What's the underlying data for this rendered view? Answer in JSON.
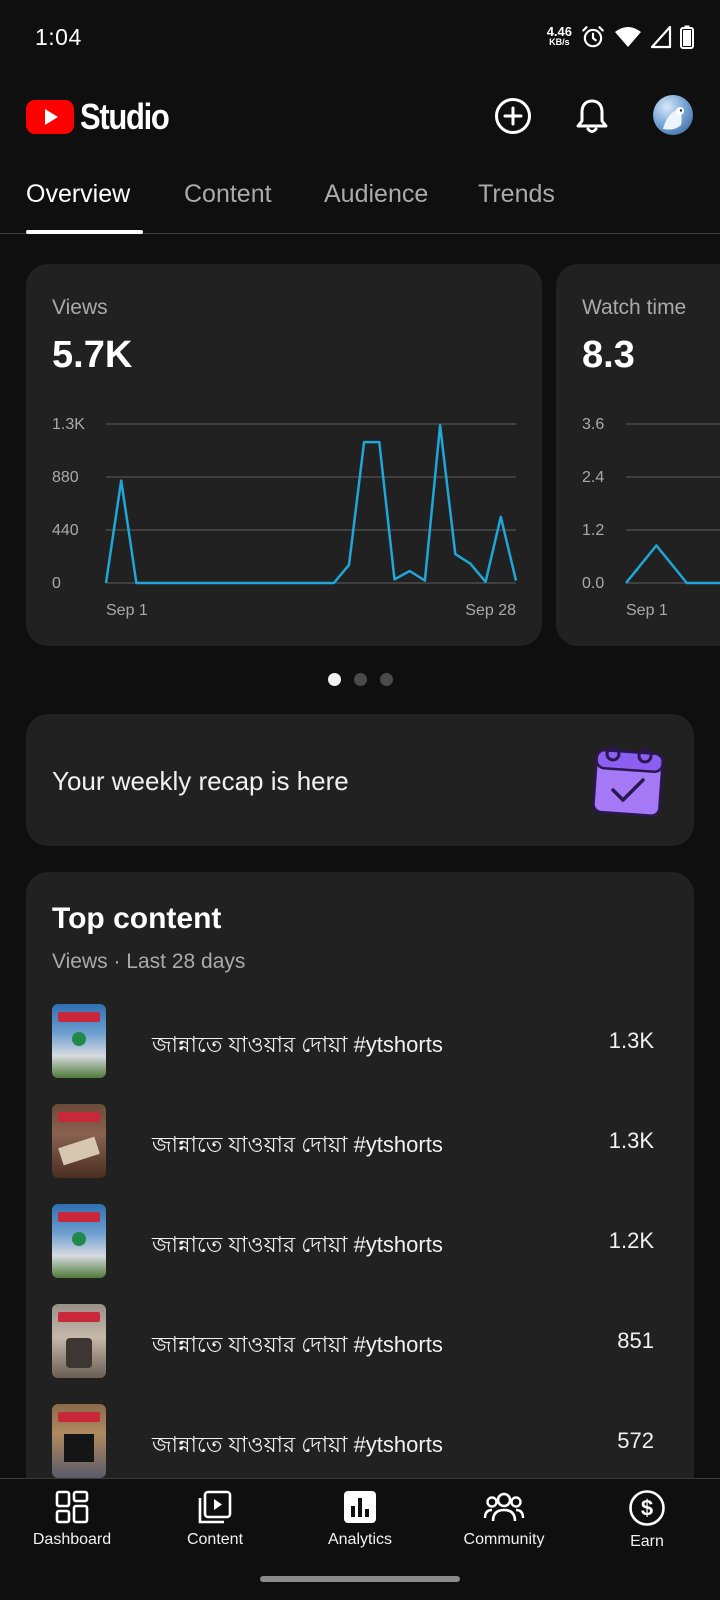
{
  "status_bar": {
    "time": "1:04",
    "net_speed_value": "4.46",
    "net_speed_unit": "KB/s"
  },
  "app": {
    "name": "Studio",
    "brand_color": "#ff0000"
  },
  "tabs": [
    {
      "label": "Overview",
      "active": true
    },
    {
      "label": "Content",
      "active": false
    },
    {
      "label": "Audience",
      "active": false
    },
    {
      "label": "Trends",
      "active": false
    }
  ],
  "metrics": [
    {
      "label": "Views",
      "value": "5.7K",
      "yticks": [
        "1.3K",
        "880",
        "440",
        "0"
      ],
      "xticks": [
        "Sep 1",
        "Sep 28"
      ]
    },
    {
      "label": "Watch time",
      "value": "8.3",
      "yticks": [
        "3.6",
        "2.4",
        "1.2",
        "0.0"
      ],
      "xticks": [
        "Sep 1"
      ]
    }
  ],
  "chart_data": [
    {
      "type": "line",
      "title": "Views",
      "x": [
        "Sep 1",
        "Sep 2",
        "Sep 3",
        "Sep 4",
        "Sep 5",
        "Sep 6",
        "Sep 7",
        "Sep 8",
        "Sep 9",
        "Sep 10",
        "Sep 11",
        "Sep 12",
        "Sep 13",
        "Sep 14",
        "Sep 15",
        "Sep 16",
        "Sep 17",
        "Sep 18",
        "Sep 19",
        "Sep 20",
        "Sep 21",
        "Sep 22",
        "Sep 23",
        "Sep 24",
        "Sep 25",
        "Sep 26",
        "Sep 27",
        "Sep 28"
      ],
      "values": [
        0,
        850,
        0,
        0,
        0,
        0,
        0,
        0,
        0,
        0,
        0,
        0,
        0,
        0,
        0,
        0,
        150,
        1170,
        1170,
        30,
        100,
        20,
        1310,
        240,
        160,
        10,
        550,
        20
      ],
      "ylim": [
        0,
        1320
      ],
      "yticks": [
        "0",
        "440",
        "880",
        "1.3K"
      ],
      "grid": true,
      "color": "#1ea7d8"
    },
    {
      "type": "line",
      "title": "Watch time",
      "x": [
        "Sep 1",
        "Sep 2",
        "Sep 3",
        "Sep 4",
        "Sep 5",
        "Sep 6"
      ],
      "values": [
        0,
        0.85,
        0,
        0,
        0,
        0
      ],
      "ylim": [
        0,
        3.6
      ],
      "yticks": [
        "0.0",
        "1.2",
        "2.4",
        "3.6"
      ],
      "grid": true,
      "color": "#1ea7d8"
    }
  ],
  "pager": {
    "count": 3,
    "active": 0
  },
  "recap": {
    "text": "Your weekly recap is here",
    "icon": "calendar-check-icon",
    "icon_color": "#9c6cf3"
  },
  "top_content": {
    "title": "Top content",
    "subtitle": "Views · Last 28 days",
    "items": [
      {
        "title": "জান্নাতে যাওয়ার দোয়া #ytshorts",
        "views": "1.3K"
      },
      {
        "title": "জান্নাতে যাওয়ার দোয়া #ytshorts",
        "views": "1.3K"
      },
      {
        "title": "জান্নাতে যাওয়ার দোয়া #ytshorts",
        "views": "1.2K"
      },
      {
        "title": "জান্নাতে যাওয়ার দোয়া #ytshorts",
        "views": "851"
      },
      {
        "title": "জান্নাতে যাওয়ার দোয়া #ytshorts",
        "views": "572"
      }
    ]
  },
  "bottom_nav": [
    {
      "label": "Dashboard",
      "icon": "dashboard-icon"
    },
    {
      "label": "Content",
      "icon": "content-icon"
    },
    {
      "label": "Analytics",
      "icon": "analytics-icon",
      "active": true
    },
    {
      "label": "Community",
      "icon": "community-icon"
    },
    {
      "label": "Earn",
      "icon": "earn-icon"
    }
  ]
}
